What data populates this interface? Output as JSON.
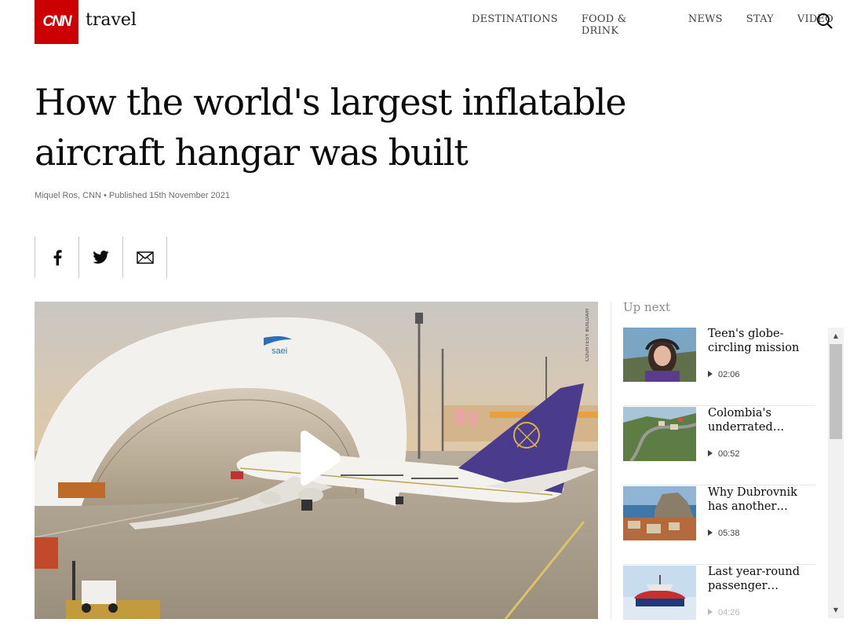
{
  "header": {
    "logo_text": "CNN",
    "section": "travel",
    "nav": [
      "DESTINATIONS",
      "FOOD & DRINK",
      "NEWS",
      "STAY",
      "VIDEO"
    ]
  },
  "article": {
    "headline": "How the world's largest inflatable aircraft hangar was built",
    "byline": "Miquel Ros, CNN • Published 15th November 2021"
  },
  "share": {
    "icons": [
      "facebook-icon",
      "twitter-icon",
      "email-icon"
    ]
  },
  "video": {
    "courtesy": "COURTESY BUILDAIR",
    "hangar_logo": "saei"
  },
  "upnext": {
    "title": "Up next",
    "items": [
      {
        "title": "Teen's globe-circling mission",
        "duration": "02:06"
      },
      {
        "title": "Colombia's underrated…",
        "duration": "00:52"
      },
      {
        "title": "Why Dubrovnik has another…",
        "duration": "05:38"
      },
      {
        "title": "Last year-round passenger…",
        "duration": "04:26"
      }
    ]
  },
  "colors": {
    "brand_red": "#cc0000",
    "tail_purple": "#4b3b8c"
  }
}
